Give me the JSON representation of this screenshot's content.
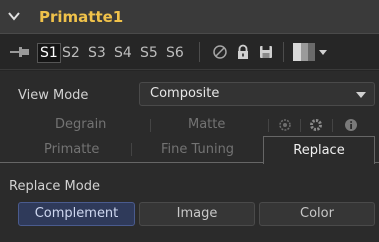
{
  "tool": {
    "name": "Primatte1",
    "collapse_icon": "chevron-down-icon"
  },
  "toolbar": {
    "pin_icon": "pin-icon",
    "slots": [
      "S1",
      "S2",
      "S3",
      "S4",
      "S5",
      "S6"
    ],
    "active_slot": "S1",
    "icons": [
      "disable-icon",
      "lock-icon",
      "save-icon",
      "color-swatch-icon"
    ]
  },
  "view_mode": {
    "label": "View Mode",
    "value": "Composite"
  },
  "tabs_row1": [
    "Degrain",
    "Matte"
  ],
  "tabs_row1_icons": [
    "settings-icon",
    "gear-icon",
    "info-icon"
  ],
  "tabs_row2": [
    "Primatte",
    "Fine Tuning",
    "Replace"
  ],
  "active_tab": "Replace",
  "replace_mode": {
    "label": "Replace Mode",
    "options": [
      "Complement",
      "Image",
      "Color"
    ],
    "selected": "Complement"
  },
  "colors": {
    "accent": "#f0c24a",
    "selected_button": "#2f3a5a"
  }
}
